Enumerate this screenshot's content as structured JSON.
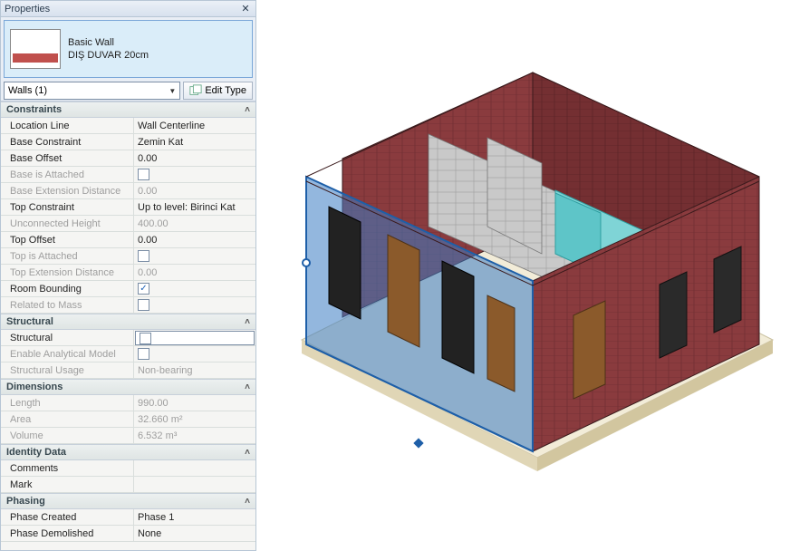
{
  "panel": {
    "title": "Properties",
    "type": {
      "family": "Basic Wall",
      "name": "DIŞ DUVAR 20cm"
    },
    "family_selector": "Walls (1)",
    "edit_type_label": "Edit Type",
    "groups": [
      {
        "header": "Constraints",
        "rows": [
          {
            "label": "Location Line",
            "value": "Wall Centerline",
            "disabled": false
          },
          {
            "label": "Base Constraint",
            "value": "Zemin Kat",
            "disabled": false
          },
          {
            "label": "Base Offset",
            "value": "0.00",
            "disabled": false
          },
          {
            "label": "Base is Attached",
            "checkbox": false,
            "disabled": true
          },
          {
            "label": "Base Extension Distance",
            "value": "0.00",
            "disabled": true
          },
          {
            "label": "Top Constraint",
            "value": "Up to level: Birinci Kat",
            "disabled": false
          },
          {
            "label": "Unconnected Height",
            "value": "400.00",
            "disabled": true
          },
          {
            "label": "Top Offset",
            "value": "0.00",
            "disabled": false
          },
          {
            "label": "Top is Attached",
            "checkbox": false,
            "disabled": true
          },
          {
            "label": "Top Extension Distance",
            "value": "0.00",
            "disabled": true
          },
          {
            "label": "Room Bounding",
            "checkbox": true,
            "disabled": false
          },
          {
            "label": "Related to Mass",
            "checkbox": false,
            "disabled": true
          }
        ]
      },
      {
        "header": "Structural",
        "rows": [
          {
            "label": "Structural",
            "checkbox": false,
            "disabled": false,
            "editable": true
          },
          {
            "label": "Enable Analytical Model",
            "checkbox": false,
            "disabled": true
          },
          {
            "label": "Structural Usage",
            "value": "Non-bearing",
            "disabled": true
          }
        ]
      },
      {
        "header": "Dimensions",
        "rows": [
          {
            "label": "Length",
            "value": "990.00",
            "disabled": true
          },
          {
            "label": "Area",
            "value": "32.660 m²",
            "disabled": true
          },
          {
            "label": "Volume",
            "value": "6.532 m³",
            "disabled": true
          }
        ]
      },
      {
        "header": "Identity Data",
        "rows": [
          {
            "label": "Comments",
            "value": "",
            "disabled": false
          },
          {
            "label": "Mark",
            "value": "",
            "disabled": false
          }
        ]
      },
      {
        "header": "Phasing",
        "rows": [
          {
            "label": "Phase Created",
            "value": "Phase 1",
            "disabled": false
          },
          {
            "label": "Phase Demolished",
            "value": "None",
            "disabled": false
          }
        ]
      }
    ]
  },
  "colors": {
    "brick": "#8a3b3e",
    "brick_light": "#a65456",
    "selection": "#4f8cc6",
    "selection_trans": "rgba(58,123,195,0.55)",
    "cmui": "#c4c4c4",
    "tile": "#7fd4d6",
    "floor": "#e6d9b8",
    "wood": "#8b5a2b"
  }
}
